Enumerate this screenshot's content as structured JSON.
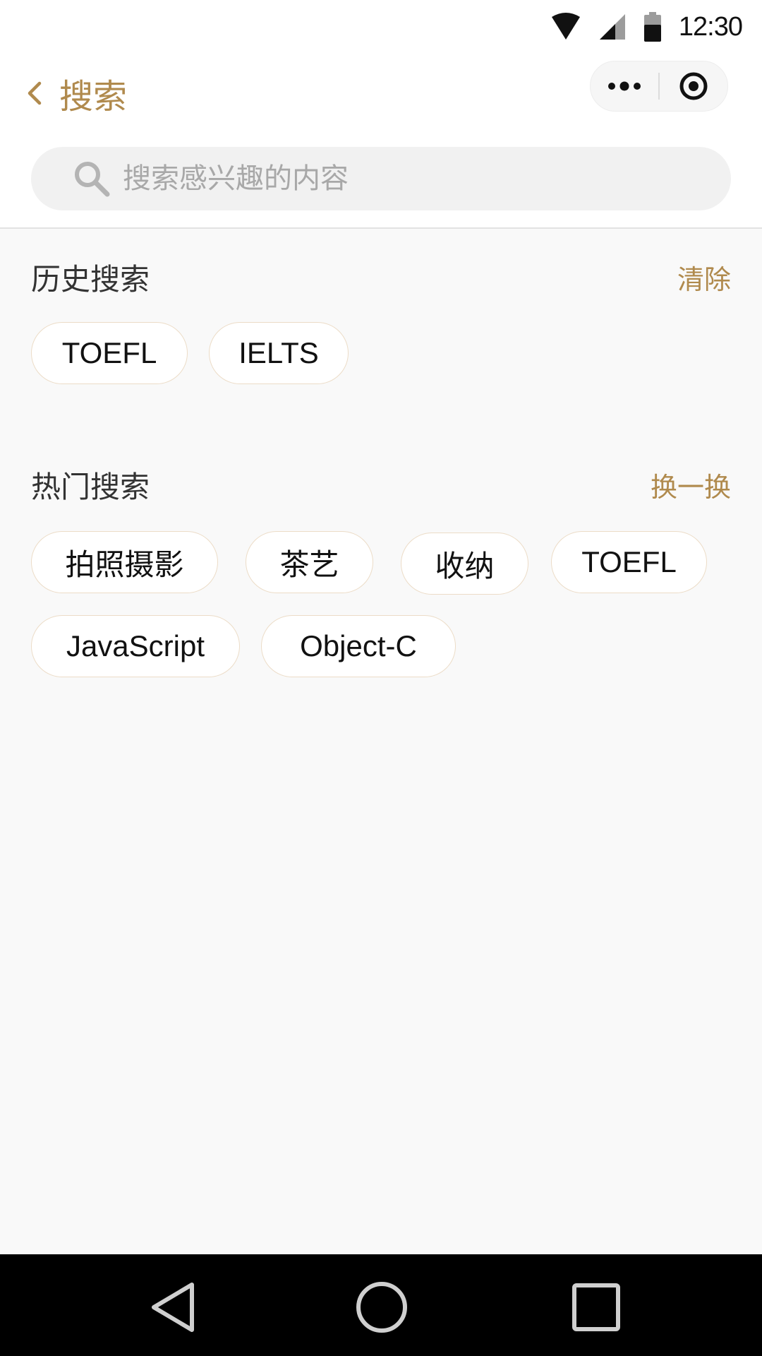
{
  "status_bar": {
    "time": "12:30",
    "icons": [
      "wifi-icon",
      "cellular-signal-icon",
      "battery-icon"
    ]
  },
  "nav": {
    "back_icon": "chevron-left-icon",
    "title": "搜索",
    "capsule": {
      "more_icon": "more-dots-icon",
      "close_icon": "target-circle-icon"
    }
  },
  "search": {
    "icon": "search-icon",
    "placeholder": "搜索感兴趣的内容",
    "value": ""
  },
  "history": {
    "title": "历史搜索",
    "action": "清除",
    "tags": [
      "TOEFL",
      "IELTS"
    ]
  },
  "hot": {
    "title": "热门搜索",
    "action": "换一换",
    "tags": [
      "拍照摄影",
      "茶艺",
      "收纳",
      "TOEFL",
      "JavaScript",
      "Object-C"
    ]
  },
  "android_nav": {
    "icons": [
      "back-triangle-icon",
      "home-circle-icon",
      "recents-square-icon"
    ]
  },
  "colors": {
    "accent": "#b08a4d",
    "background": "#f9f9f9",
    "tag_border": "#ecdcc7"
  }
}
